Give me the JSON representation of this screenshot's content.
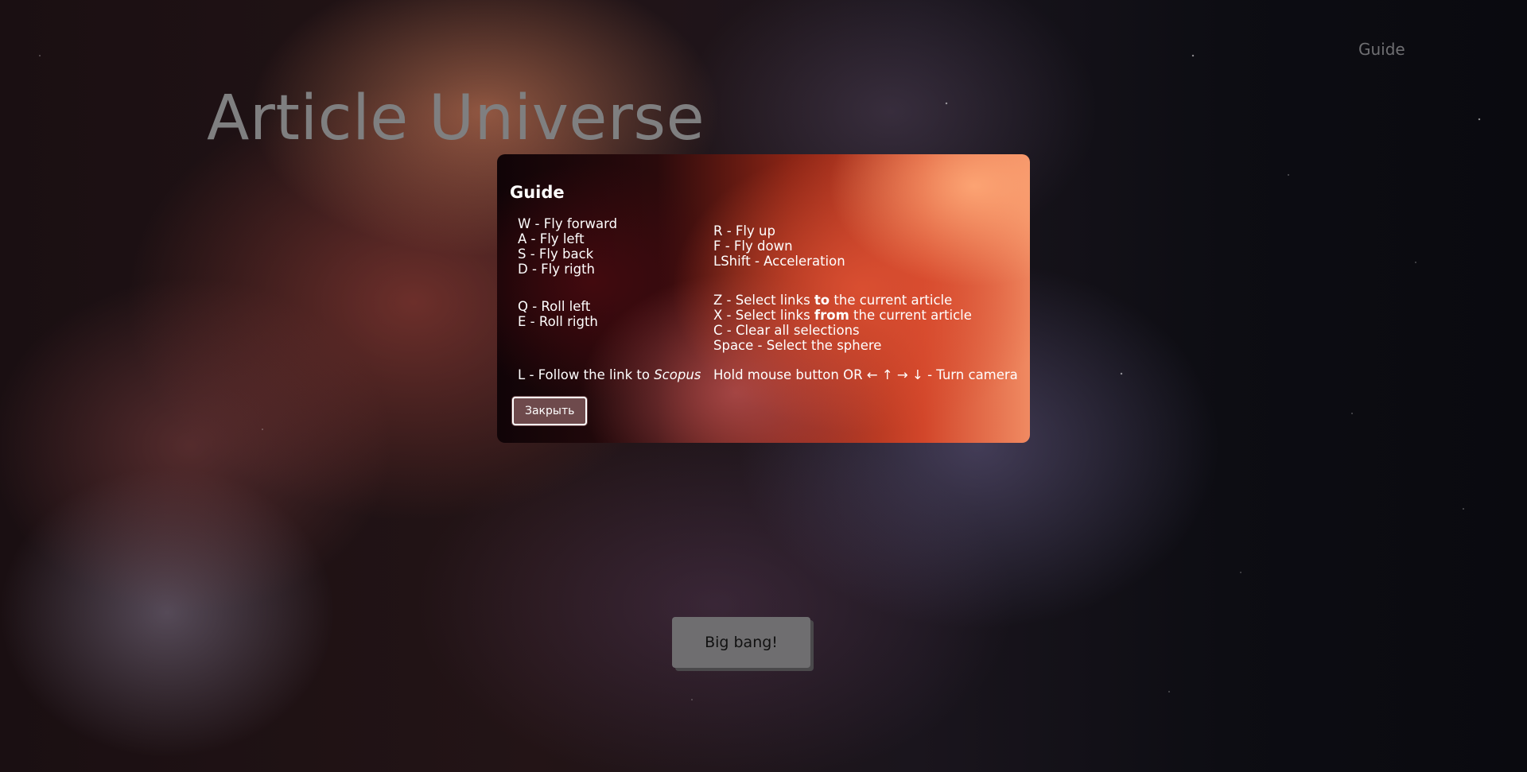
{
  "nav": {
    "guide_label": "Guide"
  },
  "header": {
    "title": "Article Universe"
  },
  "modal": {
    "title": "Guide",
    "left_group_1": [
      "W - Fly forward",
      "A - Fly left",
      "S - Fly back",
      "D - Fly rigth"
    ],
    "right_group_1": [
      "R - Fly up",
      "F - Fly down",
      "LShift - Acceleration"
    ],
    "left_group_2": [
      "Q - Roll left",
      "E - Roll rigth"
    ],
    "right_group_2": {
      "z_prefix": "Z - Select links ",
      "z_bold": "to",
      "z_suffix": " the current article",
      "x_prefix": "X - Select links ",
      "x_bold": "from",
      "x_suffix": " the current article",
      "c_line": "C - Clear all selections",
      "space_line": "Space - Select the sphere"
    },
    "left_group_3": {
      "prefix": "L - Follow the link to ",
      "italic": "Scopus"
    },
    "right_group_3": "Hold mouse button OR ← ↑ → ↓ - Turn camera",
    "close_label": "Закрыть"
  },
  "main": {
    "big_bang_label": "Big bang!"
  }
}
